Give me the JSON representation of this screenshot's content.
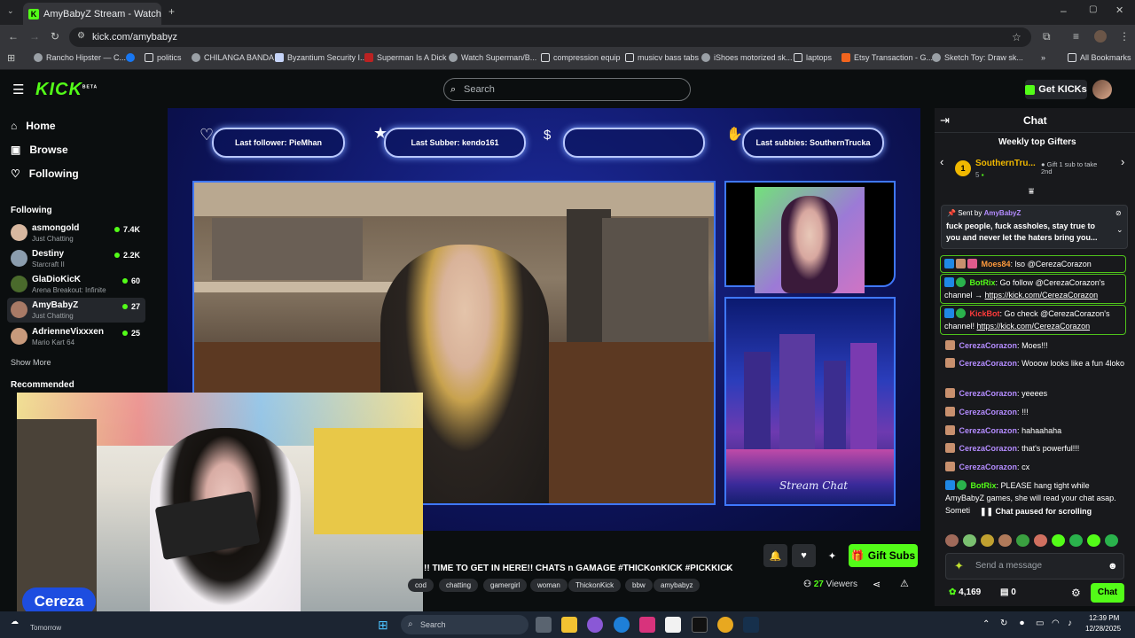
{
  "browser": {
    "tab_title": "AmyBabyZ Stream - Watch",
    "url": "kick.com/amybabyz",
    "bookmarks": [
      "Rancho Hipster — C...",
      "politics",
      "CHILANGA BANDA",
      "Byzantium Security I...",
      "Superman Is A Dick",
      "Watch Superman/B...",
      "compression equip",
      "musicv bass tabs",
      "iShoes motorized sk...",
      "laptops",
      "Etsy Transaction - G...",
      "Sketch Toy: Draw sk...",
      "All Bookmarks"
    ]
  },
  "header": {
    "logo": "KICK",
    "logo_beta": "BETA",
    "search_placeholder": "Search",
    "get_kicks": "Get KICKs"
  },
  "sidebar": {
    "nav": [
      "Home",
      "Browse",
      "Following"
    ],
    "following_title": "Following",
    "following": [
      {
        "name": "asmongold",
        "category": "Just Chatting",
        "viewers": "7.4K",
        "color": "#d8b8a0"
      },
      {
        "name": "Destiny",
        "category": "Starcraft II",
        "viewers": "2.2K",
        "color": "#8b9dae"
      },
      {
        "name": "GlaDioKicK",
        "category": "Arena Breakout: Infinite",
        "viewers": "60",
        "color": "#4a6a2c"
      },
      {
        "name": "AmyBabyZ",
        "category": "Just Chatting",
        "viewers": "27",
        "color": "#a87a66"
      },
      {
        "name": "AdrienneVixxxen",
        "category": "Mario Kart 64",
        "viewers": "25",
        "color": "#c89a7c"
      }
    ],
    "show_more": "Show More",
    "recommended_title": "Recommended"
  },
  "stream": {
    "alerts": [
      "Last follower: PieMhan",
      "Last Subber: kendo161",
      "",
      "Last subbies: SouthernTrucka"
    ],
    "overlay_label": "Stream Chat",
    "webcam_name": "Cereza"
  },
  "info": {
    "title": "!! TIME TO GET IN HERE!! CHATS n GAMAGE #THICKonKICK #PICKKICK ...",
    "tags": [
      "cod",
      "chatting",
      "gamergirl",
      "woman",
      "ThickonKick",
      "bbw",
      "amybabyz"
    ],
    "gift_subs": "Gift Subs",
    "viewers_count": "27",
    "viewers_label": "Viewers"
  },
  "chat": {
    "title": "Chat",
    "gifters_title": "Weekly top Gifters",
    "top_gifter": "SouthernTru...",
    "top_gifter_count": "5",
    "gift_prompt": "Gift 1 sub to take 2nd",
    "pinned": {
      "sent_by": "Sent by",
      "user": "AmyBabyZ",
      "text": "fuck people, fuck assholes, stay true to you and never let the haters bring you..."
    },
    "messages": [
      {
        "user": "Moes84",
        "color": "#ff9a3c",
        "text": "lso @CerezaCorazon",
        "boxed": true
      },
      {
        "user": "BotRix",
        "color": "#53fc18",
        "text": "Go follow @CerezaCorazon's channel → ",
        "link": "https://kick.com/CerezaCorazon",
        "boxed": true
      },
      {
        "user": "KickBot",
        "color": "#ff3b3b",
        "text": "Go check @CerezaCorazon's channel! ",
        "link": "https://kick.com/CerezaCorazon",
        "boxed": true
      },
      {
        "user": "CerezaCorazon",
        "color": "#b48cff",
        "text": "Moes!!!"
      },
      {
        "user": "CerezaCorazon",
        "color": "#b48cff",
        "text": "Wooow looks like a fun 4loko"
      },
      {
        "user": "CerezaCorazon",
        "color": "#b48cff",
        "text": "yeeees"
      },
      {
        "user": "CerezaCorazon",
        "color": "#b48cff",
        "text": "!!!"
      },
      {
        "user": "CerezaCorazon",
        "color": "#b48cff",
        "text": "hahaahaha"
      },
      {
        "user": "CerezaCorazon",
        "color": "#b48cff",
        "text": "that's powerful!!!"
      },
      {
        "user": "CerezaCorazon",
        "color": "#b48cff",
        "text": "cx"
      },
      {
        "user": "BotRix",
        "color": "#53fc18",
        "text": "PLEASE hang tight while AmyBabyZ games, she will read your chat asap. Someti... intense, but she PROMISES she APPRECIATES"
      }
    ],
    "paused": "Chat paused for scrolling",
    "send_placeholder": "Send a message",
    "kicks_balance": "4,169",
    "gift_balance": "0",
    "chat_button": "Chat"
  },
  "taskbar": {
    "weather": "Tomorrow",
    "search": "Search",
    "time": "12:39 PM",
    "date": "12/28/2025"
  }
}
